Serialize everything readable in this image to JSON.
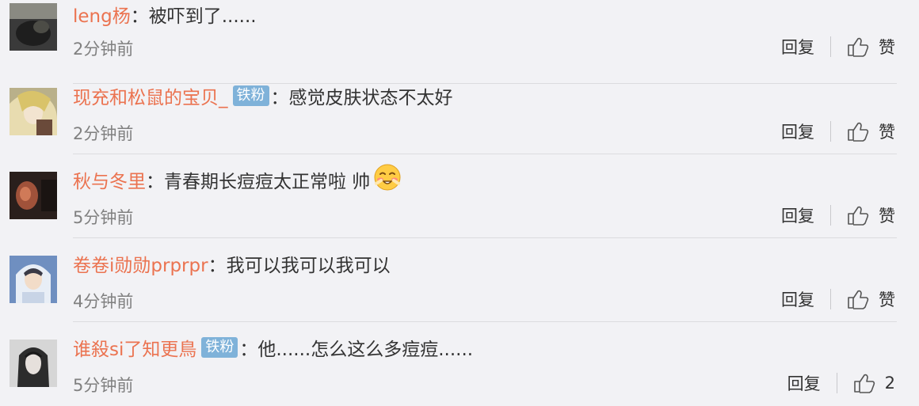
{
  "comments": [
    {
      "username": "leng杨",
      "badge": "",
      "colon": "：",
      "text": "被吓到了......",
      "time": "2分钟前",
      "reply_label": "回复",
      "like_label": "赞",
      "avatar_icon": "avatar-photo-dark"
    },
    {
      "username": "现充和松鼠的宝贝_",
      "badge": "铁粉",
      "colon": "：",
      "text": "感觉皮肤状态不太好",
      "time": "2分钟前",
      "reply_label": "回复",
      "like_label": "赞",
      "avatar_icon": "avatar-anime-girl"
    },
    {
      "username": "秋与冬里",
      "badge": "",
      "colon": "：",
      "text": "青春期长痘痘太正常啦 帅",
      "emoji": "blush-emoji",
      "time": "5分钟前",
      "reply_label": "回复",
      "like_label": "赞",
      "avatar_icon": "avatar-dark-photo"
    },
    {
      "username": "卷卷i勋勋prprpr",
      "badge": "",
      "colon": "：",
      "text": "我可以我可以我可以",
      "time": "4分钟前",
      "reply_label": "回复",
      "like_label": "赞",
      "avatar_icon": "avatar-boy-hood"
    },
    {
      "username": "谁殺si了知更鳥",
      "badge": "铁粉",
      "colon": "：",
      "text": "他......怎么这么多痘痘......",
      "time": "5分钟前",
      "reply_label": "回复",
      "like_label": "2",
      "avatar_icon": "avatar-bw-portrait"
    }
  ],
  "colors": {
    "background": "#f2f2f5",
    "username": "#eb7350",
    "badge": "#7fb2d9",
    "time": "#808080",
    "divider": "#dcdcdf"
  }
}
